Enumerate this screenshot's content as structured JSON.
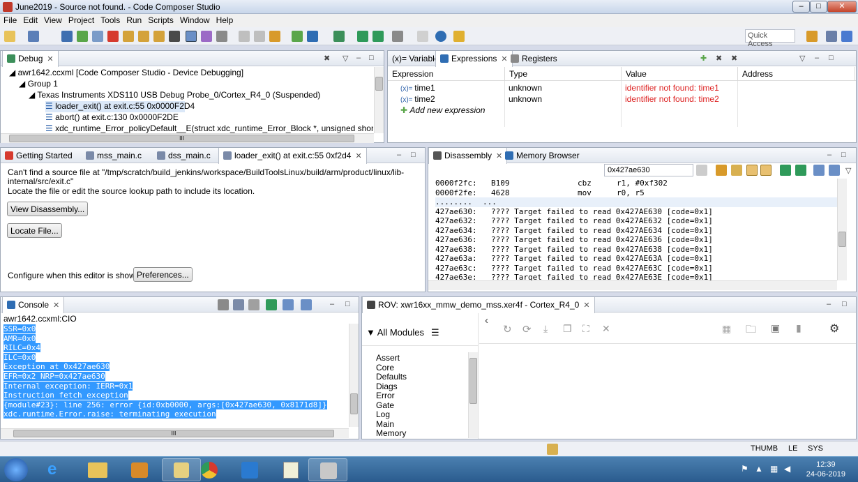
{
  "window": {
    "title": "June2019 - Source not found. - Code Composer Studio",
    "minimize": "–",
    "maximize": "□",
    "close": "✕"
  },
  "menu": [
    "File",
    "Edit",
    "View",
    "Project",
    "Tools",
    "Run",
    "Scripts",
    "Window",
    "Help"
  ],
  "toolbar": {
    "quick_access": "Quick Access"
  },
  "debug": {
    "tab": "Debug",
    "rows": [
      "awr1642.ccxml [Code Composer Studio - Device Debugging]",
      "Group 1",
      "Texas Instruments XDS110 USB Debug Probe_0/Cortex_R4_0 (Suspended)",
      "loader_exit() at exit.c:55 0x0000F2D4",
      "abort() at exit.c:130 0x0000F2DE",
      "xdc_runtime_Error_policyDefault__E(struct xdc_runtime_Error_Block *, unsigned short, unsigned"
    ],
    "hscroll": "III"
  },
  "expressions": {
    "tabs": [
      "(x)= Variables",
      "Expressions",
      "Registers"
    ],
    "headers": [
      "Expression",
      "Type",
      "Value",
      "Address"
    ],
    "rows": [
      {
        "expr": "time1",
        "type": "unknown",
        "value": "identifier not found: time1"
      },
      {
        "expr": "time2",
        "type": "unknown",
        "value": "identifier not found: time2"
      }
    ],
    "add_new": "Add new expression"
  },
  "editor": {
    "tabs": [
      "Getting Started",
      "mss_main.c",
      "dss_main.c",
      "loader_exit() at exit.c:55 0xf2d4"
    ],
    "message_line1": "Can't find a source file at \"/tmp/scratch/build_jenkins/workspace/BuildToolsLinux/build/arm/product/linux/lib-",
    "message_line2": "internal/src/exit.c\"",
    "message_line3": "Locate the file or edit the source lookup path to include its location.",
    "view_disassembly": "View Disassembly...",
    "locate_file": "Locate File...",
    "configure_label": "Configure when this editor is shown",
    "preferences": "Preferences..."
  },
  "disassembly": {
    "tabs": [
      "Disassembly",
      "Memory Browser"
    ],
    "address_input": "0x427ae630",
    "lines": [
      {
        "addr": "0000f2fc:",
        "code": "B109",
        "mn": "cbz",
        "op": "r1, #0xf302"
      },
      {
        "addr": "0000f2fe:",
        "code": "4628",
        "mn": "mov",
        "op": "r0, r5"
      },
      {
        "addr": "........",
        "code": "...",
        "mn": "",
        "op": ""
      },
      {
        "addr": "427ae630:",
        "code": "???? Target failed to read 0x427AE630 [code=0x1]",
        "mn": "",
        "op": ""
      },
      {
        "addr": "427ae632:",
        "code": "???? Target failed to read 0x427AE632 [code=0x1]",
        "mn": "",
        "op": ""
      },
      {
        "addr": "427ae634:",
        "code": "???? Target failed to read 0x427AE634 [code=0x1]",
        "mn": "",
        "op": ""
      },
      {
        "addr": "427ae636:",
        "code": "???? Target failed to read 0x427AE636 [code=0x1]",
        "mn": "",
        "op": ""
      },
      {
        "addr": "427ae638:",
        "code": "???? Target failed to read 0x427AE638 [code=0x1]",
        "mn": "",
        "op": ""
      },
      {
        "addr": "427ae63a:",
        "code": "???? Target failed to read 0x427AE63A [code=0x1]",
        "mn": "",
        "op": ""
      },
      {
        "addr": "427ae63c:",
        "code": "???? Target failed to read 0x427AE63C [code=0x1]",
        "mn": "",
        "op": ""
      },
      {
        "addr": "427ae63e:",
        "code": "???? Target failed to read 0x427AE63E [code=0x1]",
        "mn": "",
        "op": ""
      }
    ]
  },
  "console": {
    "tab": "Console",
    "source": "awr1642.ccxml:CIO",
    "lines": [
      "SSR=0x0",
      "AMR=0x0",
      "RILC=0x4",
      "ILC=0x0",
      "Exception at 0x427ae630",
      "EFR=0x2 NRP=0x427ae630",
      "Internal exception: IERR=0x1",
      "Instruction fetch exception",
      "{module#23}: line 256: error {id:0xb0000, args:[0x427ae630, 0x8171d8]}",
      "xdc.runtime.Error.raise: terminating execution"
    ],
    "hscroll": "III"
  },
  "rov": {
    "tab": "ROV: xwr16xx_mmw_demo_mss.xer4f - Cortex_R4_0",
    "all_modules": "All Modules",
    "modules": [
      "Assert",
      "Core",
      "Defaults",
      "Diags",
      "Error",
      "Gate",
      "Log",
      "Main",
      "Memory"
    ]
  },
  "status": {
    "thumb": "THUMB",
    "le": "LE",
    "sys": "SYS"
  },
  "taskbar": {
    "time": "12:39",
    "date": "24-06-2019"
  }
}
